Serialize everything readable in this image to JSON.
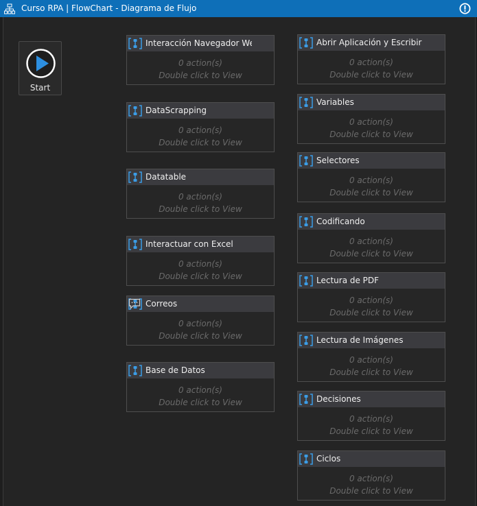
{
  "window": {
    "title": "Curso RPA | FlowChart - Diagrama de Flujo"
  },
  "start": {
    "label": "Start"
  },
  "sequences": [
    {
      "name": "Interacción Navegador Web",
      "count": "0 action(s)",
      "hint": "Double click to View"
    },
    {
      "name": "DataScrapping",
      "count": "0 action(s)",
      "hint": "Double click to View"
    },
    {
      "name": "Datatable",
      "count": "0 action(s)",
      "hint": "Double click to View"
    },
    {
      "name": "Interactuar con Excel",
      "count": "0 action(s)",
      "hint": "Double click to View"
    },
    {
      "name": "Correos",
      "count": "0 action(s)",
      "hint": "Double click to View"
    },
    {
      "name": "Base de Datos",
      "count": "0 action(s)",
      "hint": "Double click to View"
    },
    {
      "name": "Abrir Aplicación y Escribir",
      "count": "0 action(s)",
      "hint": "Double click to View"
    },
    {
      "name": "Variables",
      "count": "0 action(s)",
      "hint": "Double click to View"
    },
    {
      "name": "Selectores",
      "count": "0 action(s)",
      "hint": "Double click to View"
    },
    {
      "name": "Codificando",
      "count": "0 action(s)",
      "hint": "Double click to View"
    },
    {
      "name": "Lectura de PDF",
      "count": "0 action(s)",
      "hint": "Double click to View"
    },
    {
      "name": "Lectura de Imágenes",
      "count": "0 action(s)",
      "hint": "Double click to View"
    },
    {
      "name": "Decisiones",
      "count": "0 action(s)",
      "hint": "Double click to View"
    },
    {
      "name": "Ciclos",
      "count": "0 action(s)",
      "hint": "Double click to View"
    }
  ],
  "icons": {
    "titlebar": "flowchart-icon",
    "info": "info-icon",
    "start": "play-icon",
    "sequence": "sequence-icon",
    "note": "comment-icon"
  },
  "colors": {
    "accent": "#0e6fb8",
    "canvas": "#242424",
    "header": "#3b3b3f",
    "muted_text": "#6b6b6b"
  }
}
